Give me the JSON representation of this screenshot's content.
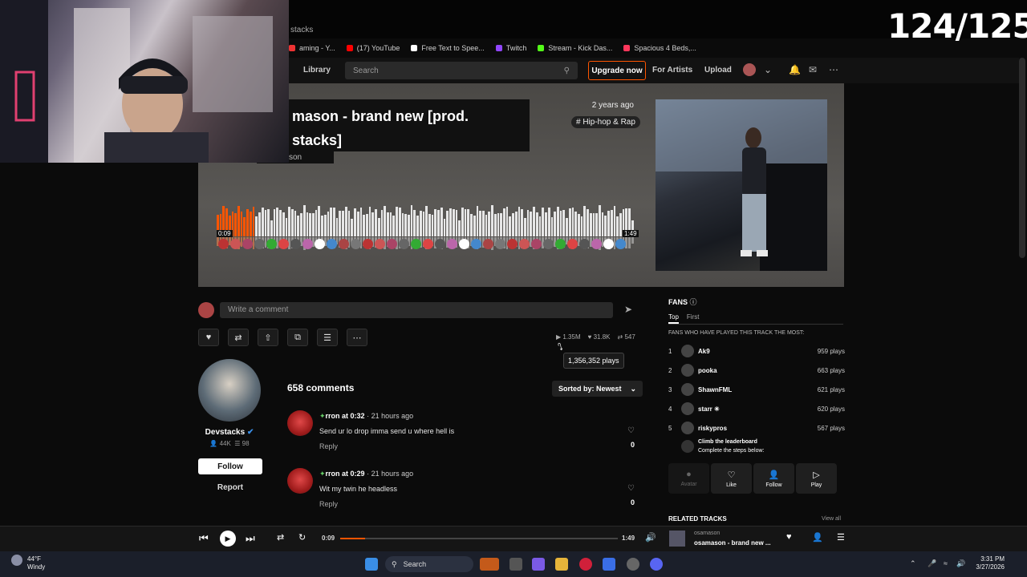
{
  "overlay": {
    "counter": "124/125"
  },
  "browser": {
    "tab_title_fragment": "stacks",
    "bookmarks": [
      {
        "label": "aming - Y...",
        "color": "#e33"
      },
      {
        "label": "(17) YouTube",
        "color": "#f00"
      },
      {
        "label": "Free Text to Spee...",
        "color": "#fff"
      },
      {
        "label": "Twitch",
        "color": "#9146ff"
      },
      {
        "label": "Stream - Kick Das...",
        "color": "#53fc18"
      },
      {
        "label": "Spacious 4 Beds,...",
        "color": "#ff385c"
      }
    ]
  },
  "header": {
    "library": "Library",
    "search_placeholder": "Search",
    "upgrade": "Upgrade now",
    "for_artists": "For Artists",
    "upload": "Upload"
  },
  "track": {
    "title_line1": "mason - brand new [prod.",
    "title_line2": "stacks]",
    "artist_fragment": "son",
    "posted": "2 years ago",
    "genre": "# Hip-hop & Rap",
    "time_current": "0:09",
    "time_total": "1:49",
    "played_fraction": 0.09
  },
  "comment_box": {
    "placeholder": "Write a comment"
  },
  "stats": {
    "plays": "1.35M",
    "likes": "31.8K",
    "reposts": "547",
    "plays_tooltip": "1,356,352 plays"
  },
  "uploader": {
    "name": "Devstacks",
    "followers": "44K",
    "tracks": "98",
    "follow": "Follow",
    "report": "Report"
  },
  "comments": {
    "count": "658 comments",
    "sort": "Sorted by: Newest",
    "items": [
      {
        "user": "rron at 0:32",
        "when": "21 hours ago",
        "text": "Send ur lo drop imma send u where hell is",
        "reply": "Reply",
        "likes": "0"
      },
      {
        "user": "rron at 0:29",
        "when": "21 hours ago",
        "text": "Wit my twin he headless",
        "reply": "Reply",
        "likes": "0"
      }
    ]
  },
  "fans": {
    "title": "FANS",
    "tabs": [
      "Top",
      "First"
    ],
    "subtitle": "FANS WHO HAVE PLAYED THIS TRACK THE MOST:",
    "list": [
      {
        "rank": "1",
        "name": "Ak9",
        "plays": "959 plays"
      },
      {
        "rank": "2",
        "name": "pooka",
        "plays": "663 plays"
      },
      {
        "rank": "3",
        "name": "ShawnFML",
        "plays": "621 plays"
      },
      {
        "rank": "4",
        "name": "starr ✳",
        "plays": "620 plays"
      },
      {
        "rank": "5",
        "name": "riskypros",
        "plays": "567 plays"
      }
    ],
    "climb_title": "Climb the leaderboard",
    "climb_sub": "Complete the steps below:",
    "steps": [
      "Avatar",
      "Like",
      "Follow",
      "Play"
    ]
  },
  "related": {
    "title": "RELATED TRACKS",
    "view_all": "View all"
  },
  "player": {
    "time_current": "0:09",
    "time_total": "1:49",
    "progress": 0.09,
    "np_artist": "osamason",
    "np_title": "osamason - brand new ..."
  },
  "taskbar": {
    "temp": "44°F",
    "weather": "Windy",
    "search": "Search",
    "time": "3:31 PM",
    "date": "3/27/2026"
  },
  "colors": {
    "accent": "#ff5500",
    "verified": "#3a8ee6"
  }
}
